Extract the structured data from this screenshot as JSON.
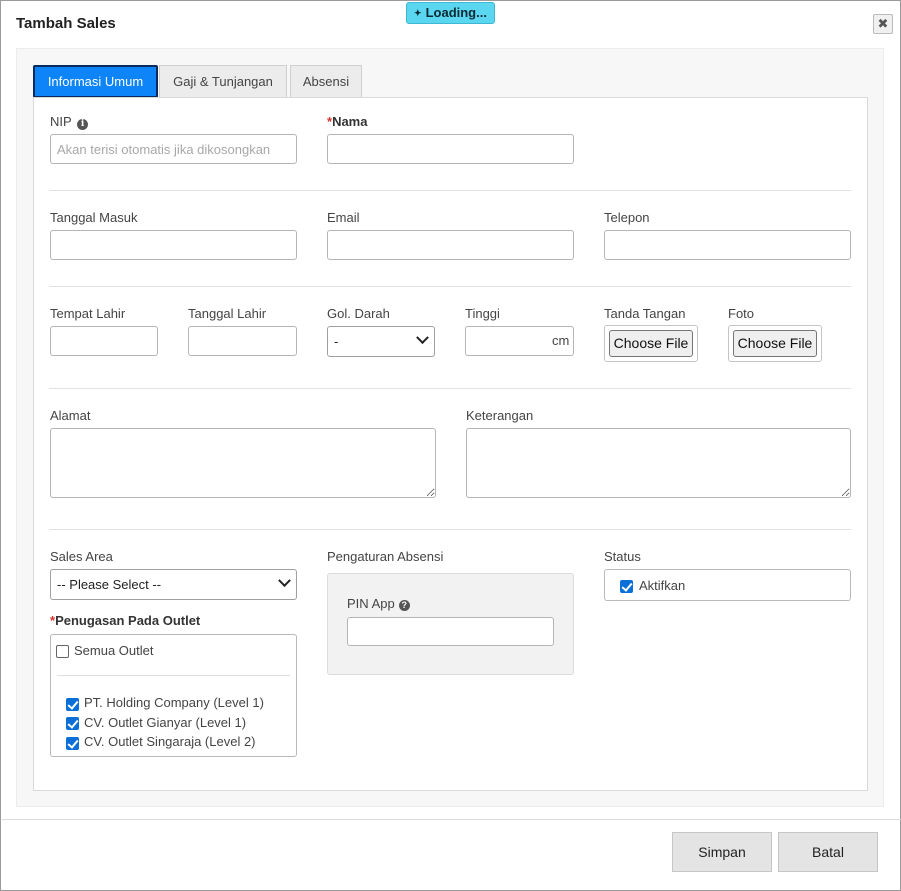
{
  "dialog": {
    "title": "Tambah Sales",
    "close_label": "✖",
    "loading_text": "Loading..."
  },
  "tabs": [
    {
      "label": "Informasi Umum",
      "active": true
    },
    {
      "label": "Gaji & Tunjangan",
      "active": false
    },
    {
      "label": "Absensi",
      "active": false
    }
  ],
  "form": {
    "nip": {
      "label": "NIP",
      "placeholder": "Akan terisi otomatis jika dikosongkan",
      "value": ""
    },
    "nama": {
      "label": "Nama",
      "required_mark": "*",
      "value": ""
    },
    "tanggal_masuk": {
      "label": "Tanggal Masuk",
      "value": ""
    },
    "email": {
      "label": "Email",
      "value": ""
    },
    "telepon": {
      "label": "Telepon",
      "value": ""
    },
    "tempat_lahir": {
      "label": "Tempat Lahir",
      "value": ""
    },
    "tanggal_lahir": {
      "label": "Tanggal Lahir",
      "value": ""
    },
    "gol_darah": {
      "label": "Gol. Darah",
      "selected": "-"
    },
    "tinggi": {
      "label": "Tinggi",
      "suffix": "cm",
      "value": ""
    },
    "tanda_tangan": {
      "label": "Tanda Tangan",
      "button": "Choose File"
    },
    "foto": {
      "label": "Foto",
      "button": "Choose File"
    },
    "alamat": {
      "label": "Alamat",
      "value": ""
    },
    "keterangan": {
      "label": "Keterangan",
      "value": ""
    },
    "sales_area": {
      "label": "Sales Area",
      "selected": "-- Please Select --"
    },
    "pengaturan_absensi": {
      "label": "Pengaturan Absensi",
      "pin_label": "PIN App",
      "pin_value": ""
    },
    "status": {
      "label": "Status",
      "checkbox_label": "Aktifkan",
      "checked": true
    },
    "outlet": {
      "label": "Penugasan Pada Outlet",
      "required_mark": "*",
      "all_label": "Semua Outlet",
      "all_checked": false,
      "items": [
        {
          "label": "PT. Holding Company (Level 1)",
          "checked": true
        },
        {
          "label": "CV. Outlet Gianyar (Level 1)",
          "checked": true
        },
        {
          "label": "CV. Outlet Singaraja (Level 2)",
          "checked": true
        }
      ]
    }
  },
  "footer": {
    "save_label": "Simpan",
    "cancel_label": "Batal"
  },
  "colors": {
    "accent": "#0d84f7",
    "loading": "#5ad6f0",
    "required": "#d9322a",
    "checkbox": "#0b6fd8"
  },
  "icons": {
    "nip_info": "info-circle-icon",
    "pin_help": "question-circle-icon",
    "close": "close-icon"
  }
}
